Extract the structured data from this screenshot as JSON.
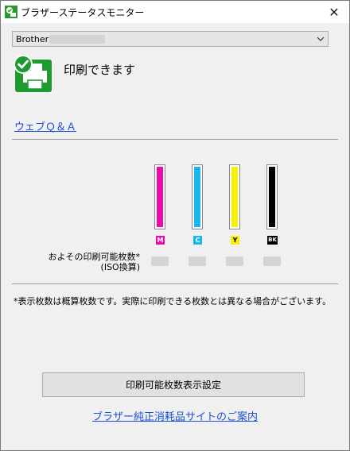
{
  "window": {
    "title": "ブラザーステータスモニター"
  },
  "printer_select": {
    "value": "Brother"
  },
  "status": {
    "text": "印刷できます"
  },
  "links": {
    "qa": "ウェブＱ＆Ａ",
    "supplies_site": "ブラザー純正消耗品サイトのご案内"
  },
  "inks": [
    {
      "label": "M",
      "color": "#ee0aa8"
    },
    {
      "label": "C",
      "color": "#1ab7ee"
    },
    {
      "label": "Y",
      "color": "#f8f000"
    },
    {
      "label": "BK",
      "color": "#000000"
    }
  ],
  "page_count": {
    "label_line1": "およその印刷可能枚数*",
    "label_line2": "(ISO換算)"
  },
  "note": "*表示枚数は概算枚数です。実際に印刷できる枚数とは異なる場合がございます。",
  "buttons": {
    "display_settings": "印刷可能枚数表示設定"
  }
}
